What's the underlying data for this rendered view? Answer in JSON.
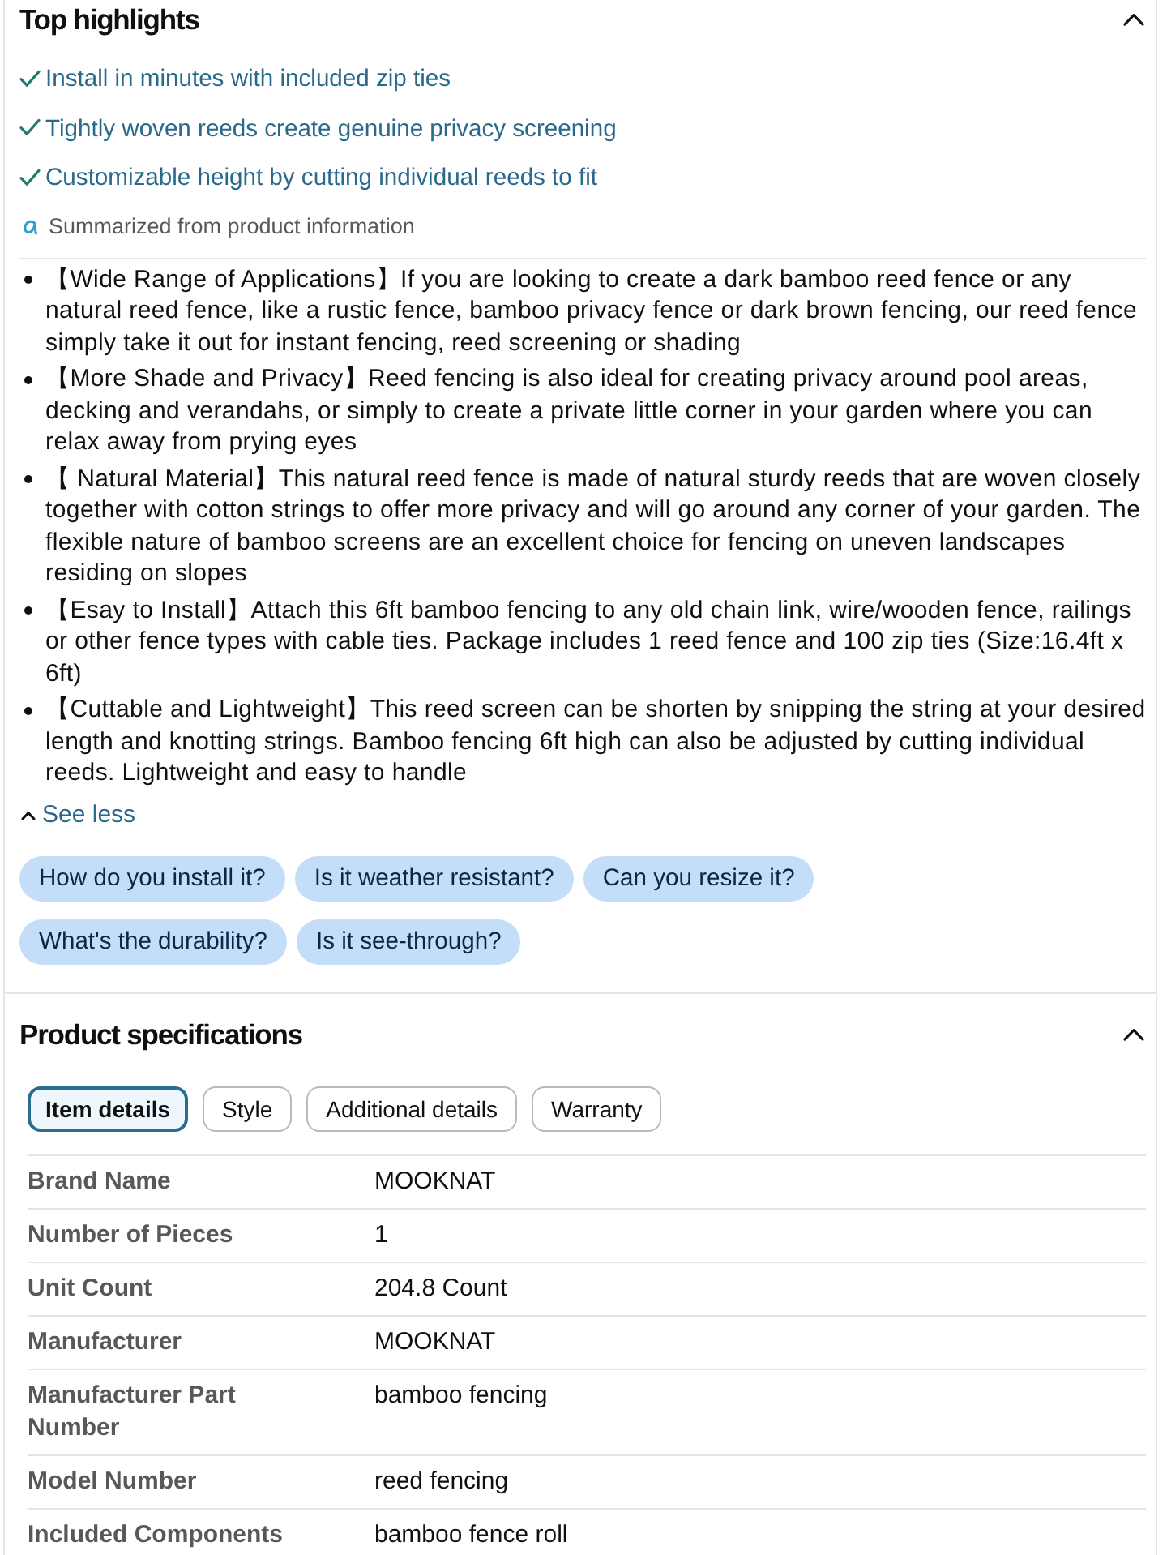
{
  "highlights_section": {
    "title": "Top highlights",
    "expanded": true,
    "highlights": [
      "Install in minutes with included zip ties",
      "Tightly woven reeds create genuine privacy screening",
      "Customizable height by cutting individual reeds to fit"
    ],
    "summary_note": "Summarized from product information",
    "bullets": [
      "【Wide Range of Applications】If you are looking to create a dark bamboo reed fence or any natural reed fence, like a rustic fence, bamboo privacy fence or dark brown fencing, our reed fence simply take it out for instant fencing, reed screening or shading",
      "【More Shade and Privacy】Reed fencing is also ideal for creating privacy around pool areas, decking and verandahs, or simply to create a private little corner in your garden where you can relax away from prying eyes",
      "【 Natural Material】This natural reed fence is made of natural sturdy reeds that are woven closely together with cotton strings to offer more privacy and will go around any corner of your garden. The flexible nature of bamboo screens are an excellent choice for fencing on uneven landscapes residing on slopes",
      "【Esay to Install】Attach this 6ft bamboo fencing to any old chain link, wire/wooden fence, railings or other fence types with cable ties. Package includes 1 reed fence and 100 zip ties (Size:16.4ft x 6ft)",
      "【Cuttable and Lightweight】This reed screen can be shorten by snipping the string at your desired length and knotting strings. Bamboo fencing 6ft high can also be adjusted by cutting individual reeds. Lightweight and easy to handle"
    ],
    "see_less": "See less",
    "suggested_questions": [
      "How do you install it?",
      "Is it weather resistant?",
      "Can you resize it?",
      "What's the durability?",
      "Is it see-through?"
    ]
  },
  "specifications_section": {
    "title": "Product specifications",
    "expanded": true,
    "tabs": [
      {
        "label": "Item details",
        "selected": true
      },
      {
        "label": "Style",
        "selected": false
      },
      {
        "label": "Additional details",
        "selected": false
      },
      {
        "label": "Warranty",
        "selected": false
      }
    ],
    "rows": [
      {
        "label": "Brand Name",
        "value": "MOOKNAT"
      },
      {
        "label": "Number of Pieces",
        "value": "1"
      },
      {
        "label": "Unit Count",
        "value": "204.8 Count"
      },
      {
        "label": "Manufacturer",
        "value": "MOOKNAT"
      },
      {
        "label": "Manufacturer Part Number",
        "value": "bamboo fencing"
      },
      {
        "label": "Model Number",
        "value": "reed fencing"
      },
      {
        "label": "Included Components",
        "value": "bamboo fence roll"
      }
    ]
  }
}
